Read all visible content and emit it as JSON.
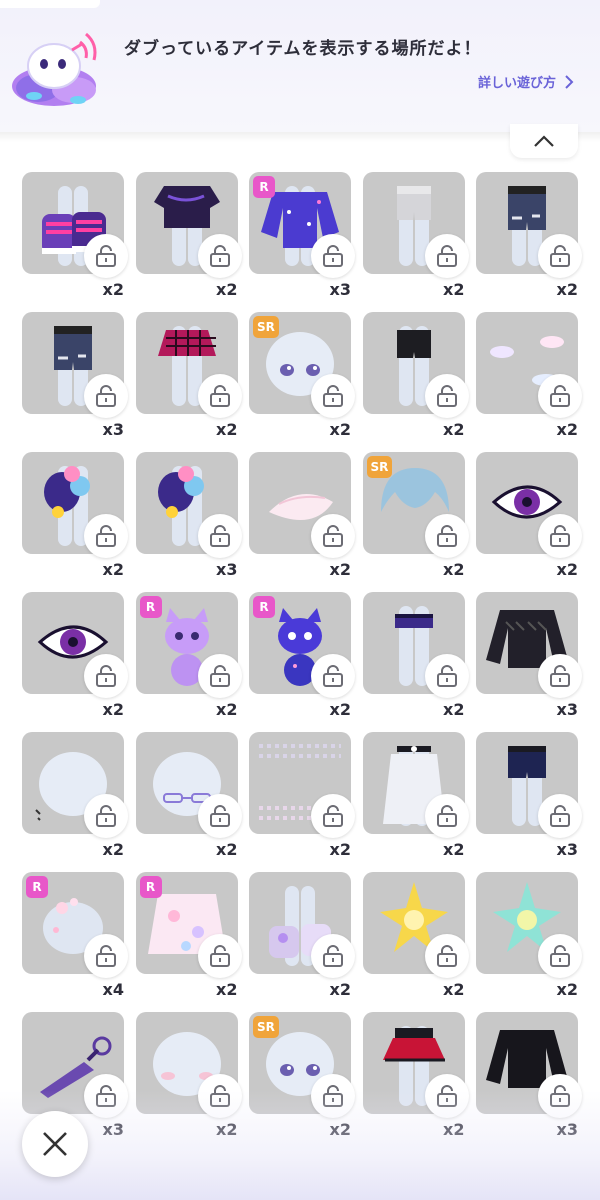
{
  "header": {
    "message": "ダブっているアイテムを表示する場所だよ！",
    "guide_link": "詳しい遊び方"
  },
  "items": [
    {
      "art": "shoes-icon",
      "count": "x2",
      "rarity": ""
    },
    {
      "art": "tshirt-icon",
      "count": "x2",
      "rarity": ""
    },
    {
      "art": "galaxy-jacket-icon",
      "count": "x3",
      "rarity": "R"
    },
    {
      "art": "shorts-icon",
      "count": "x2",
      "rarity": ""
    },
    {
      "art": "denim-shorts-icon",
      "count": "x2",
      "rarity": ""
    },
    {
      "art": "denim-shorts-icon",
      "count": "x3",
      "rarity": ""
    },
    {
      "art": "plaid-skirt-icon",
      "count": "x2",
      "rarity": ""
    },
    {
      "art": "face-icon",
      "count": "x2",
      "rarity": "SR"
    },
    {
      "art": "black-shorts-icon",
      "count": "x2",
      "rarity": ""
    },
    {
      "art": "cloud-effect-icon",
      "count": "x2",
      "rarity": ""
    },
    {
      "art": "plush-backpack-icon",
      "count": "x2",
      "rarity": ""
    },
    {
      "art": "plush-backpack-icon",
      "count": "x3",
      "rarity": ""
    },
    {
      "art": "feather-icon",
      "count": "x2",
      "rarity": ""
    },
    {
      "art": "hair-icon",
      "count": "x2",
      "rarity": "SR"
    },
    {
      "art": "eye-icon",
      "count": "x2",
      "rarity": ""
    },
    {
      "art": "eye-icon",
      "count": "x2",
      "rarity": ""
    },
    {
      "art": "cat-pet-icon",
      "count": "x2",
      "rarity": "R"
    },
    {
      "art": "galaxy-cat-pet-icon",
      "count": "x2",
      "rarity": "R"
    },
    {
      "art": "belt-icon",
      "count": "x2",
      "rarity": ""
    },
    {
      "art": "lace-top-icon",
      "count": "x3",
      "rarity": ""
    },
    {
      "art": "head-icon",
      "count": "x2",
      "rarity": ""
    },
    {
      "art": "glasses-icon",
      "count": "x2",
      "rarity": ""
    },
    {
      "art": "sparkle-background-icon",
      "count": "x2",
      "rarity": ""
    },
    {
      "art": "choker-icon",
      "count": "x2",
      "rarity": ""
    },
    {
      "art": "navy-shorts-icon",
      "count": "x3",
      "rarity": ""
    },
    {
      "art": "flower-accessory-icon",
      "count": "x4",
      "rarity": "R"
    },
    {
      "art": "kimono-icon",
      "count": "x2",
      "rarity": "R"
    },
    {
      "art": "socks-icon",
      "count": "x2",
      "rarity": ""
    },
    {
      "art": "gold-star-effect-icon",
      "count": "x2",
      "rarity": ""
    },
    {
      "art": "holo-star-effect-icon",
      "count": "x2",
      "rarity": ""
    },
    {
      "art": "kunai-icon",
      "count": "x3",
      "rarity": ""
    },
    {
      "art": "blush-icon",
      "count": "x2",
      "rarity": ""
    },
    {
      "art": "face-icon",
      "count": "x2",
      "rarity": "SR"
    },
    {
      "art": "red-skirt-icon",
      "count": "x2",
      "rarity": ""
    },
    {
      "art": "black-jacket-icon",
      "count": "x3",
      "rarity": ""
    }
  ],
  "colors": {
    "accent": "#6a63d8",
    "tile": "#c8c8c8",
    "rarity_r": "#e857c9",
    "rarity_sr": "#f0a43a"
  }
}
